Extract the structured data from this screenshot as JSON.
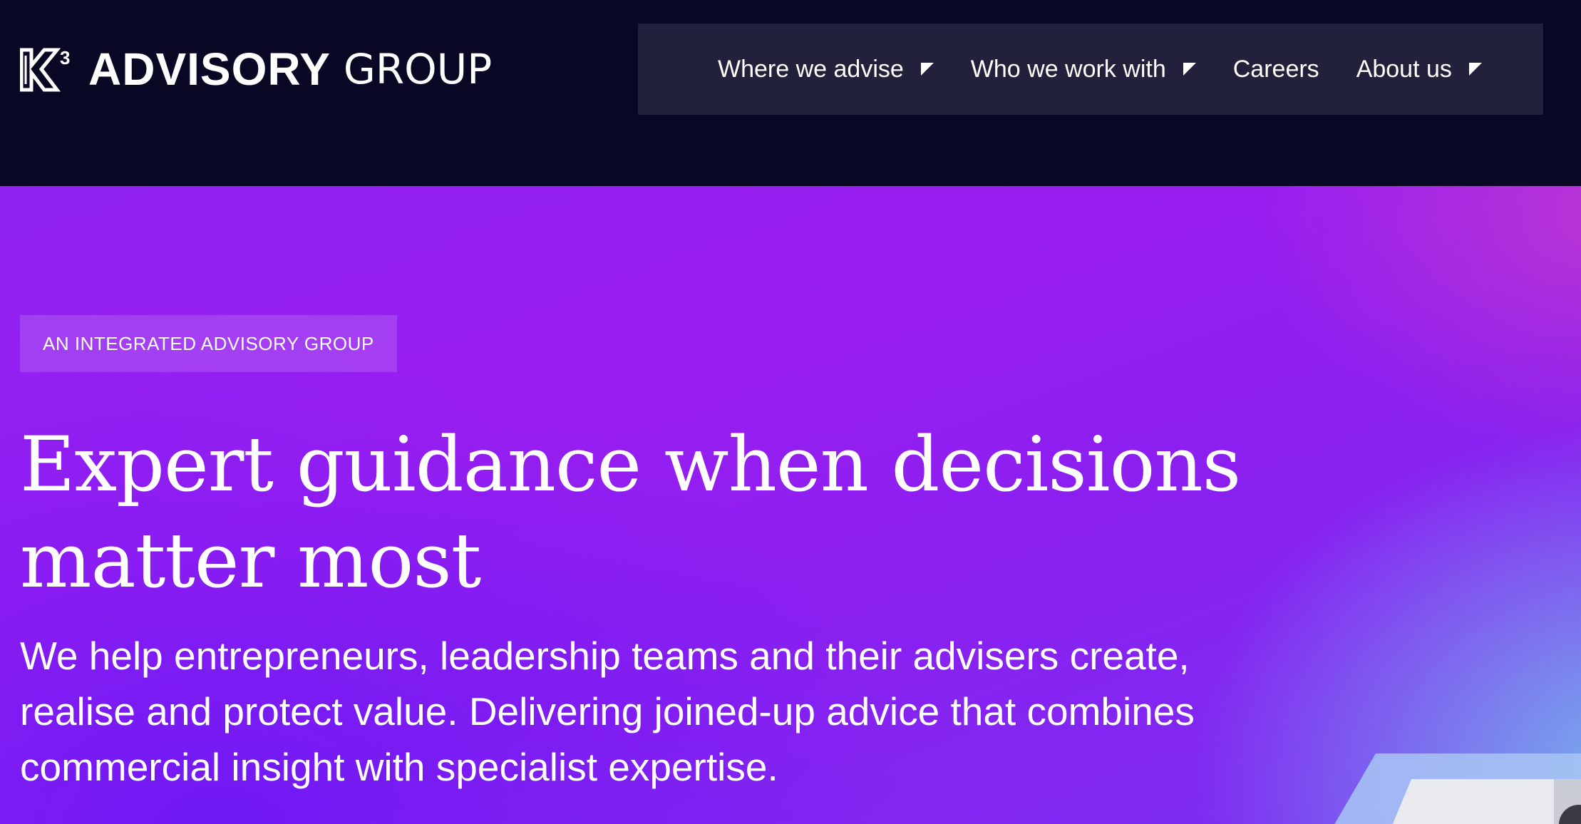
{
  "brand": {
    "mark": "K³",
    "name_bold": "ADVISORY",
    "name_light": "GROUP",
    "colors": {
      "header_bg": "#080824",
      "nav_bg": "#21213b",
      "hero_purple": "#9a1ef0",
      "hero_blue_glow": "#78c8eb",
      "text": "#ffffff"
    }
  },
  "nav": {
    "items": [
      {
        "label": "Where we advise",
        "has_dropdown": true
      },
      {
        "label": "Who we work with",
        "has_dropdown": true
      },
      {
        "label": "Careers",
        "has_dropdown": false
      },
      {
        "label": "About us",
        "has_dropdown": true
      }
    ]
  },
  "hero": {
    "eyebrow": "AN INTEGRATED ADVISORY GROUP",
    "headline": "Expert guidance when decisions matter most",
    "subtext": "We help entrepreneurs, leadership teams and their advisers create, realise and protect value. Delivering joined-up advice that combines commercial insight with specialist expertise."
  }
}
